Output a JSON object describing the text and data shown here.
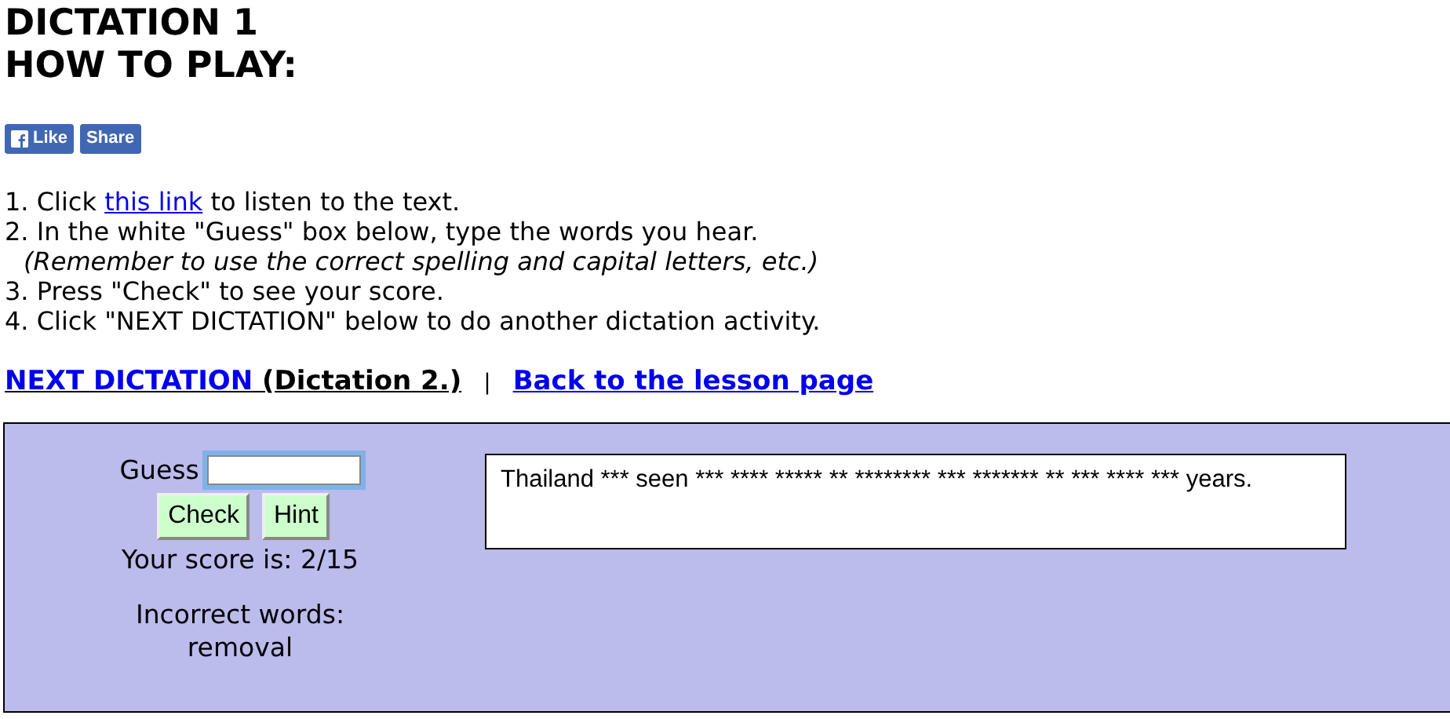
{
  "title": "DICTATION 1",
  "subtitle": "HOW TO PLAY:",
  "social_buttons": [
    {
      "kind": "like",
      "label": "Like"
    },
    {
      "kind": "share",
      "label": "Share"
    }
  ],
  "instructions": [
    {
      "kind": "link",
      "prefix": "1. Click ",
      "link": "this link",
      "suffix": " to listen to the text."
    },
    {
      "kind": "plain",
      "text": "2. In the white \"Guess\" box below, type the words you hear."
    },
    {
      "kind": "note",
      "text": "(Remember to use the correct spelling and capital letters, etc.)"
    },
    {
      "kind": "plain",
      "text": "3. Press \"Check\" to see your score."
    },
    {
      "kind": "plain",
      "text": "4. Click \"NEXT DICTATION\" below to do another dictation activity."
    }
  ],
  "nav": {
    "next_link": "NEXT DICTATION",
    "next_note": "(Dictation 2.)",
    "separator": "|",
    "back_link": "Back to the lesson page"
  },
  "game": {
    "guess_label": "Guess",
    "guess_focused": true,
    "buttons": [
      "Check",
      "Hint"
    ],
    "score": "Your score is: 2/15",
    "incorrect_label": "Incorrect words:",
    "incorrect_words": "removal",
    "passage": "Thailand *** seen *** **** ***** ** ******** *** ******* ** *** **** *** years."
  }
}
